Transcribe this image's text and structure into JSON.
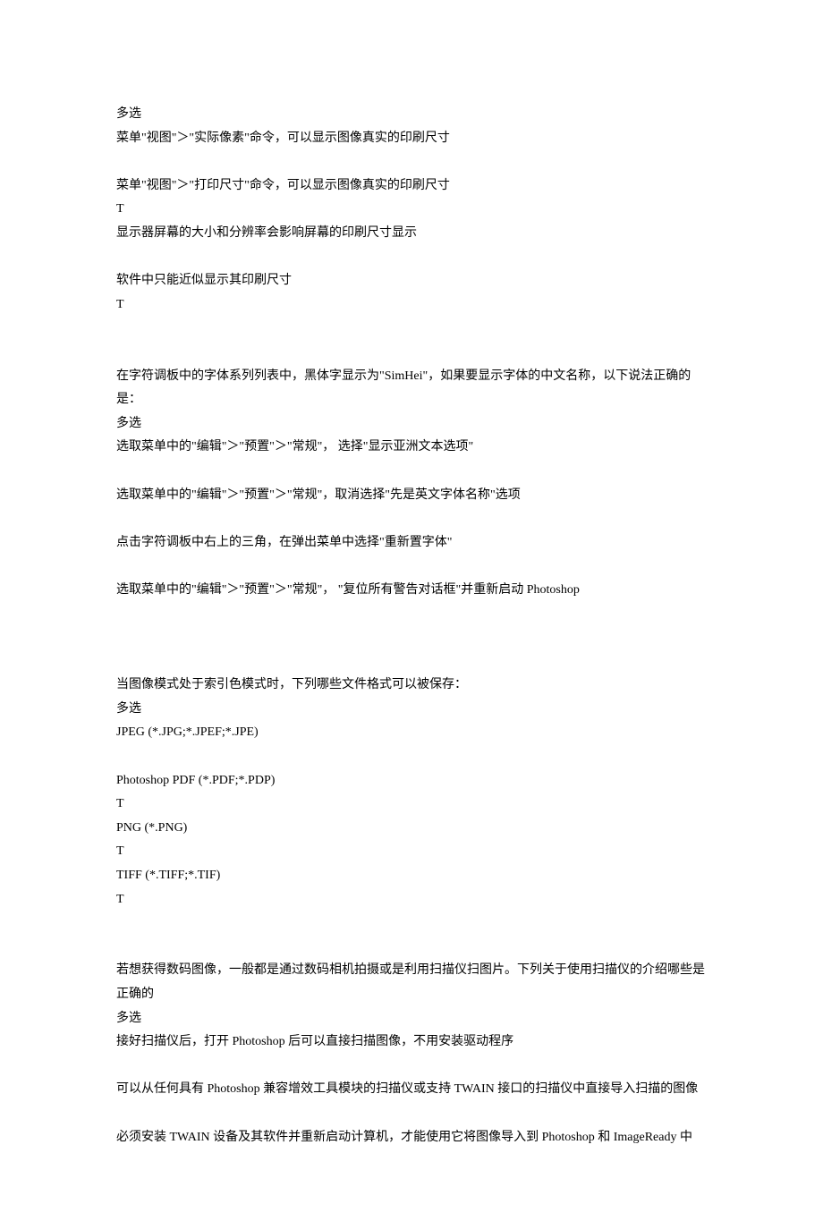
{
  "lines": [
    "多选",
    "菜单\"视图\"＞\"实际像素\"命令，可以显示图像真实的印刷尺寸",
    "",
    "菜单\"视图\"＞\"打印尺寸\"命令，可以显示图像真实的印刷尺寸",
    "T",
    "显示器屏幕的大小和分辨率会影响屏幕的印刷尺寸显示",
    "",
    "软件中只能近似显示其印刷尺寸",
    "T",
    "",
    "",
    "在字符调板中的字体系列列表中，黑体字显示为\"SimHei\"，如果要显示字体的中文名称，以下说法正确的是：",
    "多选",
    "选取菜单中的\"编辑\"＞\"预置\"＞\"常规\"， 选择\"显示亚洲文本选项\"",
    "",
    "选取菜单中的\"编辑\"＞\"预置\"＞\"常规\"，取消选择\"先是英文字体名称\"选项",
    "",
    "点击字符调板中右上的三角，在弹出菜单中选择\"重新置字体\"",
    "",
    "选取菜单中的\"编辑\"＞\"预置\"＞\"常规\"， \"复位所有警告对话框\"并重新启动 Photoshop",
    "",
    "",
    "",
    "当图像模式处于索引色模式时，下列哪些文件格式可以被保存：",
    "多选",
    "JPEG (*.JPG;*.JPEF;*.JPE)",
    "",
    "Photoshop PDF (*.PDF;*.PDP)",
    "T",
    "PNG (*.PNG)",
    "T",
    "TIFF (*.TIFF;*.TIF)",
    "T",
    "",
    "",
    "若想获得数码图像，一般都是通过数码相机拍摄或是利用扫描仪扫图片。下列关于使用扫描仪的介绍哪些是正确的",
    "多选",
    "接好扫描仪后，打开 Photoshop 后可以直接扫描图像，不用安装驱动程序",
    "",
    "可以从任何具有 Photoshop 兼容增效工具模块的扫描仪或支持 TWAIN 接口的扫描仪中直接导入扫描的图像",
    "",
    "必须安装 TWAIN 设备及其软件并重新启动计算机，才能使用它将图像导入到 Photoshop 和 ImageReady 中"
  ]
}
